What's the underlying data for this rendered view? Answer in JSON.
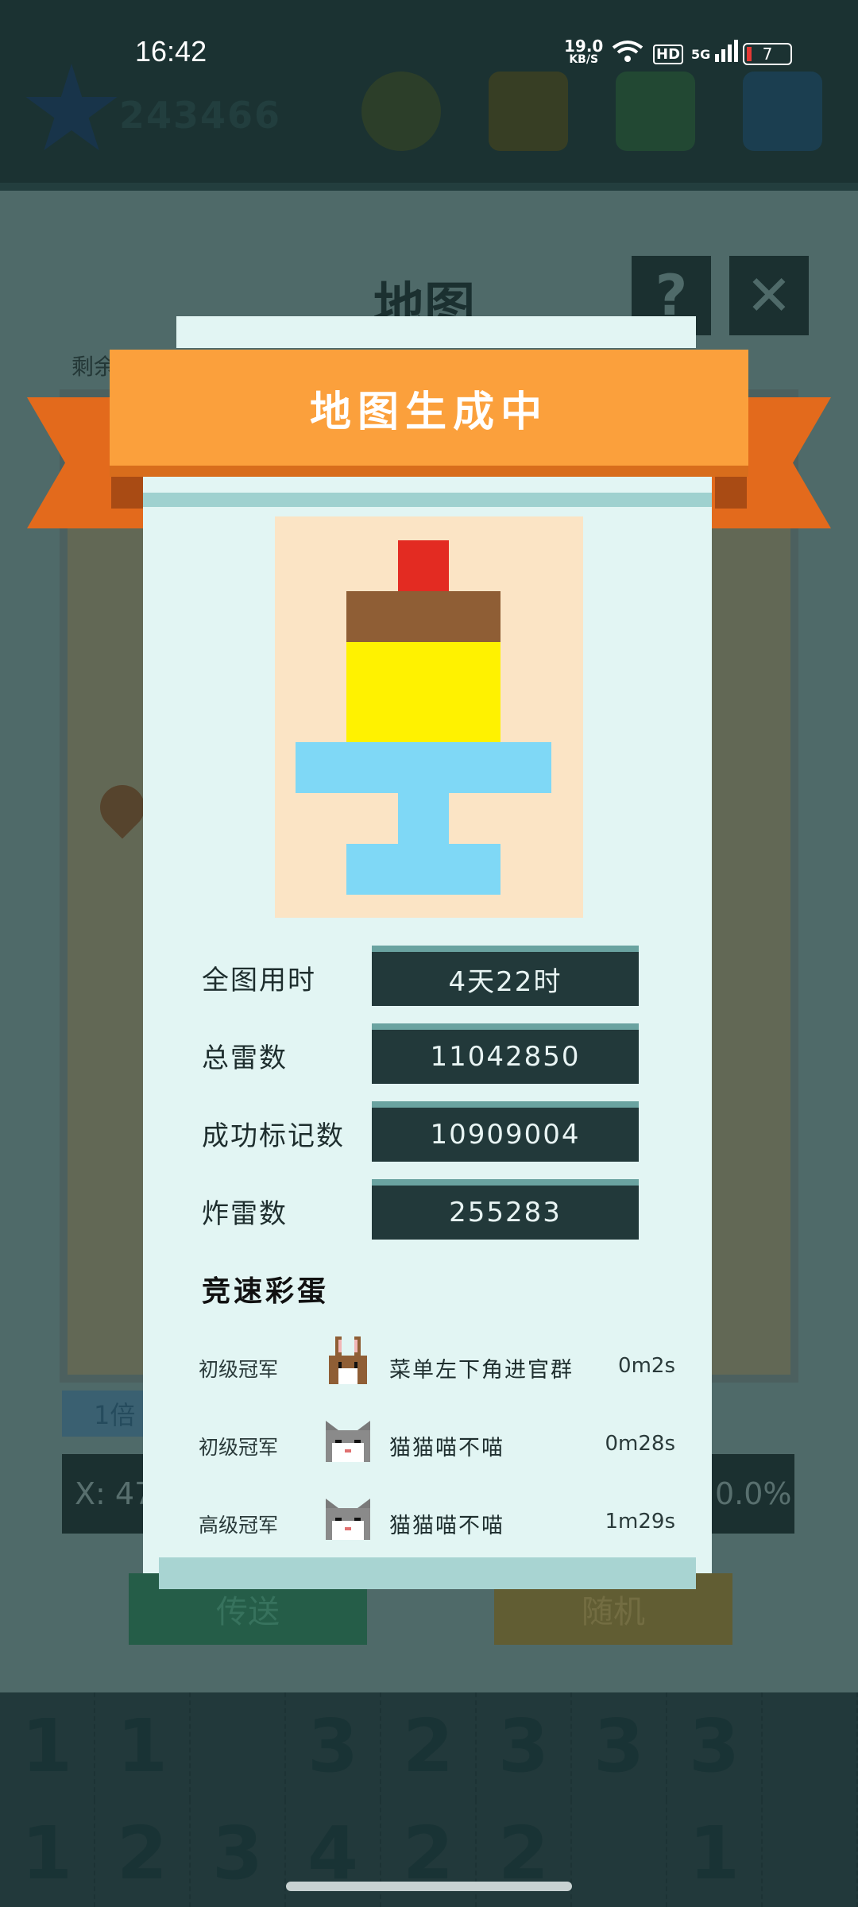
{
  "status_bar": {
    "time": "16:42",
    "net_speed_value": "19.0",
    "net_speed_unit": "KB/S",
    "hd_label": "HD",
    "signal_label": "5G",
    "battery_level": "7"
  },
  "background": {
    "coin_count": "243466",
    "map_title": "地图",
    "remaining_label": "剩余",
    "help_label": "?",
    "close_label": "✕",
    "zoom_label": "1倍",
    "coord_x": "X: 47",
    "progress_percent": "0.0%",
    "teleport_label": "传送",
    "random_label": "随机",
    "board_row1": [
      "1",
      "1",
      "",
      "3",
      "2",
      "3",
      "3",
      "3"
    ],
    "board_row2": [
      "1",
      "2",
      "3",
      "4",
      "2",
      "2",
      "",
      "1"
    ]
  },
  "modal": {
    "title": "地图生成中",
    "stats": [
      {
        "label": "全图用时",
        "value": "4天22时"
      },
      {
        "label": "总雷数",
        "value": "11042850"
      },
      {
        "label": "成功标记数",
        "value": "10909004"
      },
      {
        "label": "炸雷数",
        "value": "255283"
      }
    ],
    "race_title": "竞速彩蛋",
    "race_entries": [
      {
        "rank": "初级冠军",
        "avatar": "rabbit-icon",
        "name": "菜单左下角进官群",
        "time": "0m2s"
      },
      {
        "rank": "初级冠军",
        "avatar": "cat-icon",
        "name": "猫猫喵不喵",
        "time": "0m28s"
      },
      {
        "rank": "高级冠军",
        "avatar": "cat-icon",
        "name": "猫猫喵不喵",
        "time": "1m29s"
      }
    ]
  },
  "colors": {
    "ribbon": "#fba03c",
    "ribbon_wing": "#e36a1c",
    "modal_bg": "#e2f5f3",
    "stat_box": "#22393a",
    "art_bg": "#fbe4c5",
    "art_red": "#e32b22",
    "art_brown": "#8f5e35",
    "art_yellow": "#fff200",
    "art_blue": "#7fd8f6"
  }
}
